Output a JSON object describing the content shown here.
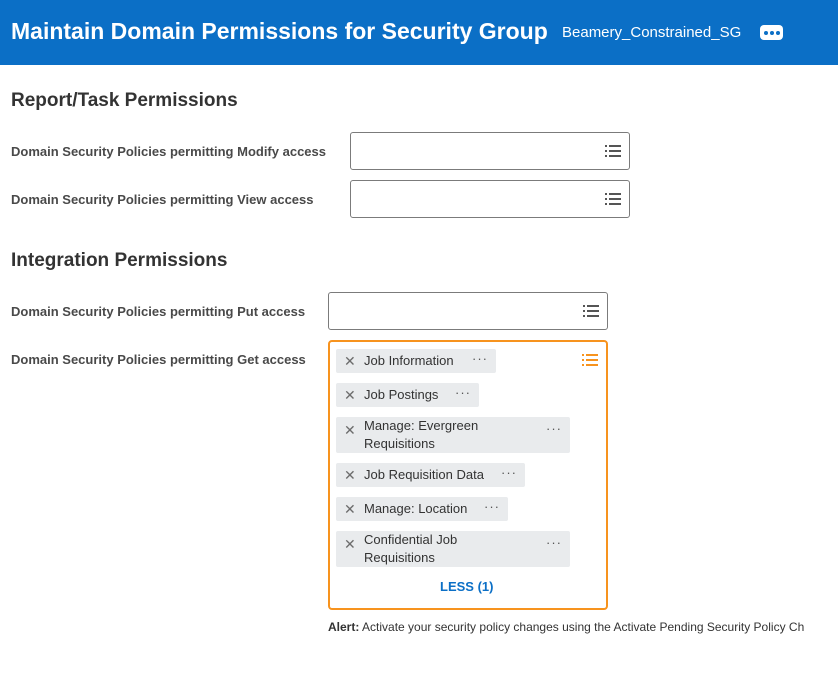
{
  "header": {
    "title": "Maintain Domain Permissions for Security Group",
    "group_name": "Beamery_Constrained_SG"
  },
  "report_task": {
    "title": "Report/Task Permissions",
    "modify_label": "Domain Security Policies permitting Modify access",
    "view_label": "Domain Security Policies permitting View access"
  },
  "integration": {
    "title": "Integration Permissions",
    "put_label": "Domain Security Policies permitting Put access",
    "get_label": "Domain Security Policies permitting Get access",
    "get_items": [
      "Job Information",
      "Job Postings",
      "Manage: Evergreen\nRequisitions",
      "Job Requisition Data",
      "Manage: Location",
      "Confidential Job\nRequisitions"
    ],
    "less_label": "LESS (1)"
  },
  "alert": {
    "label": "Alert:",
    "text": "Activate your security policy changes using the Activate Pending Security Policy Ch"
  },
  "colors": {
    "header_bg": "#0b6fc6",
    "focus_border": "#f7931e",
    "link": "#0b6fc6",
    "pill_bg": "#e9ebed"
  },
  "icons": {
    "more": "more-horizontal-icon",
    "prompt": "list-icon",
    "remove": "close-icon"
  }
}
